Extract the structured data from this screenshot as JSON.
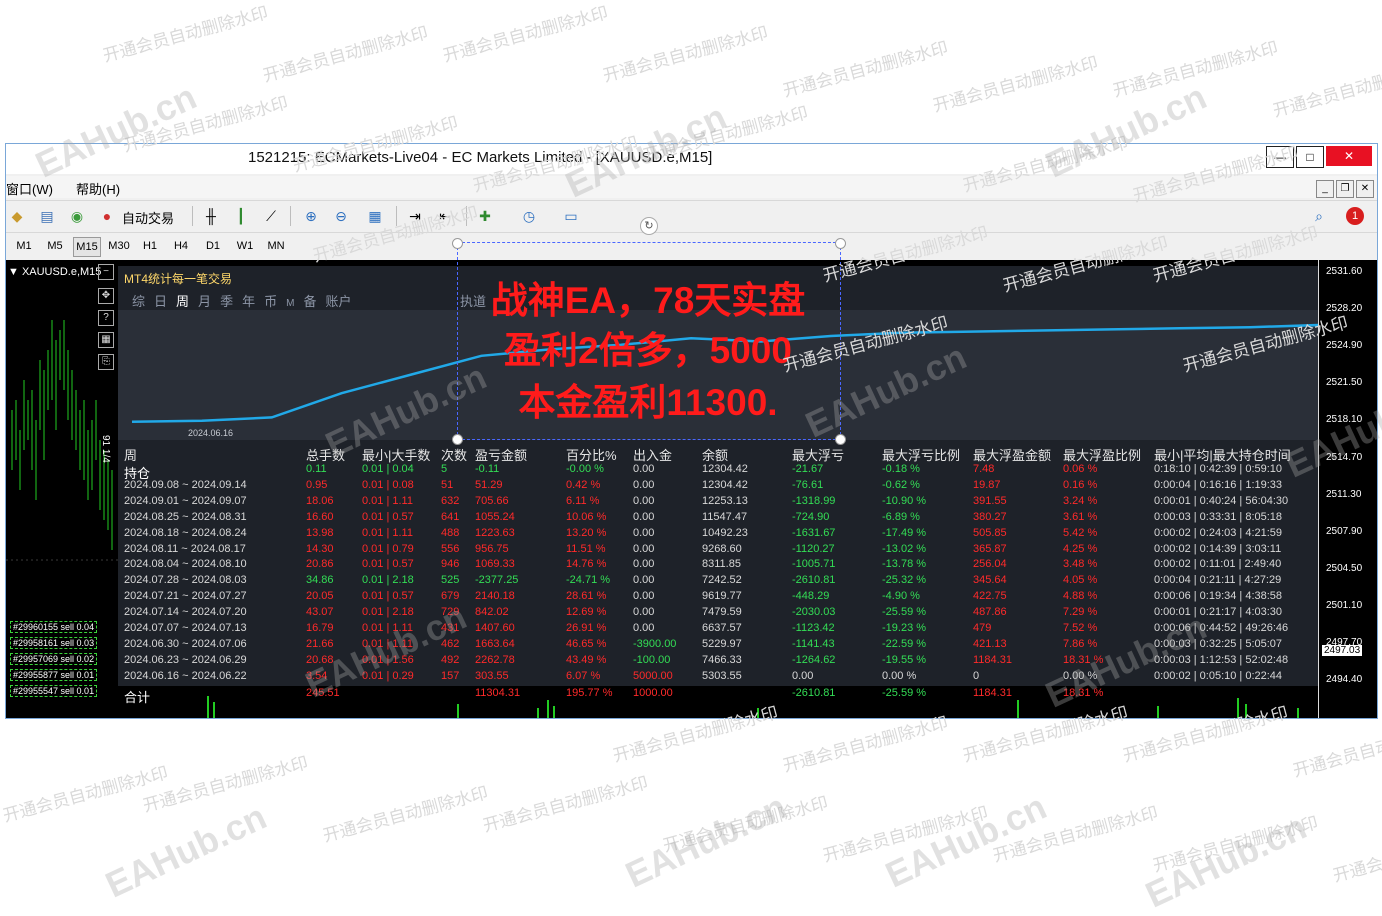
{
  "window": {
    "title": "1521215: ECMarkets-Live04 - EC Markets Limited - [XAUUSD.e,M15]",
    "minimize": "—",
    "maximize": "□",
    "close": "✕"
  },
  "menu": {
    "items": [
      "窗口(W)",
      "帮助(H)"
    ]
  },
  "toolbar": {
    "auto_trading_label": "自动交易"
  },
  "timeframes": [
    "M1",
    "M5",
    "M15",
    "M30",
    "H1",
    "H4",
    "D1",
    "W1",
    "MN"
  ],
  "chart": {
    "symbol_label": "▼ XAUUSD.e,M15",
    "side_label": "91 1/4",
    "price_ticks": [
      "2531.60",
      "2528.20",
      "2524.90",
      "2521.50",
      "2518.10",
      "2514.70",
      "2511.30",
      "2507.90",
      "2504.50",
      "2501.10",
      "2497.70",
      "2494.40"
    ],
    "current_price": "2497.03",
    "orders": [
      "#29960155 sell 0.04",
      "#29958161 sell 0.03",
      "#29957069 sell 0.02",
      "#29955877 sell 0.01",
      "#29955547 sell 0.01"
    ]
  },
  "panel": {
    "title": "MT4统计每一笔交易",
    "tabs": [
      "综",
      "日",
      "周",
      "月",
      "季",
      "年",
      "币",
      "M",
      "备",
      "账户"
    ],
    "active_tab": "周",
    "hidden_tab": "执道",
    "equity_date": "2024.06.16",
    "equity_curve": [
      0.12,
      0.13,
      0.16,
      0.38,
      0.55,
      0.72,
      0.78,
      0.82,
      0.88,
      0.85,
      0.9,
      0.93,
      0.94,
      0.95,
      0.96,
      0.97,
      0.98,
      1.0
    ],
    "headers": [
      "周",
      "总手数",
      "最小|大手数",
      "次数",
      "盈亏金额",
      "百分比%",
      "出入金",
      "余额",
      "最大浮亏",
      "最大浮亏比例",
      "最大浮盈金额",
      "最大浮盈比例",
      "最小|平均|最大持仓时间"
    ],
    "rows": [
      {
        "p": "持仓",
        "lots": "0.11",
        "mm": "0.01 | 0.04",
        "n": "5",
        "pl": "-0.11",
        "pct": "-0.00 %",
        "io": "0.00",
        "bal": "12304.42",
        "dd": "-21.67",
        "ddp": "-0.18 %",
        "mf": "7.48",
        "mfp": "0.06 %",
        "t": "0:18:10 | 0:42:39 | 0:59:10",
        "c": "g"
      },
      {
        "p": "2024.09.08 ~ 2024.09.14",
        "lots": "0.95",
        "mm": "0.01 | 0.08",
        "n": "51",
        "pl": "51.29",
        "pct": "0.42 %",
        "io": "0.00",
        "bal": "12304.42",
        "dd": "-76.61",
        "ddp": "-0.62 %",
        "mf": "19.87",
        "mfp": "0.16 %",
        "t": "0:00:04 | 0:16:16 | 1:19:33",
        "c": "r"
      },
      {
        "p": "2024.09.01 ~ 2024.09.07",
        "lots": "18.06",
        "mm": "0.01 | 1.11",
        "n": "632",
        "pl": "705.66",
        "pct": "6.11 %",
        "io": "0.00",
        "bal": "12253.13",
        "dd": "-1318.99",
        "ddp": "-10.90 %",
        "mf": "391.55",
        "mfp": "3.24 %",
        "t": "0:00:01 | 0:40:24 | 56:04:30",
        "c": "r"
      },
      {
        "p": "2024.08.25 ~ 2024.08.31",
        "lots": "16.60",
        "mm": "0.01 | 0.57",
        "n": "641",
        "pl": "1055.24",
        "pct": "10.06 %",
        "io": "0.00",
        "bal": "11547.47",
        "dd": "-724.90",
        "ddp": "-6.89 %",
        "mf": "380.27",
        "mfp": "3.61 %",
        "t": "0:00:03 | 0:33:31 | 8:05:18",
        "c": "r"
      },
      {
        "p": "2024.08.18 ~ 2024.08.24",
        "lots": "13.98",
        "mm": "0.01 | 1.11",
        "n": "488",
        "pl": "1223.63",
        "pct": "13.20 %",
        "io": "0.00",
        "bal": "10492.23",
        "dd": "-1631.67",
        "ddp": "-17.49 %",
        "mf": "505.85",
        "mfp": "5.42 %",
        "t": "0:00:02 | 0:24:03 | 4:21:59",
        "c": "r"
      },
      {
        "p": "2024.08.11 ~ 2024.08.17",
        "lots": "14.30",
        "mm": "0.01 | 0.79",
        "n": "556",
        "pl": "956.75",
        "pct": "11.51 %",
        "io": "0.00",
        "bal": "9268.60",
        "dd": "-1120.27",
        "ddp": "-13.02 %",
        "mf": "365.87",
        "mfp": "4.25 %",
        "t": "0:00:02 | 0:14:39 | 3:03:11",
        "c": "r"
      },
      {
        "p": "2024.08.04 ~ 2024.08.10",
        "lots": "20.86",
        "mm": "0.01 | 0.57",
        "n": "946",
        "pl": "1069.33",
        "pct": "14.76 %",
        "io": "0.00",
        "bal": "8311.85",
        "dd": "-1005.71",
        "ddp": "-13.78 %",
        "mf": "256.04",
        "mfp": "3.48 %",
        "t": "0:00:02 | 0:11:01 | 2:49:40",
        "c": "r"
      },
      {
        "p": "2024.07.28 ~ 2024.08.03",
        "lots": "34.86",
        "mm": "0.01 | 2.18",
        "n": "525",
        "pl": "-2377.25",
        "pct": "-24.71 %",
        "io": "0.00",
        "bal": "7242.52",
        "dd": "-2610.81",
        "ddp": "-25.32 %",
        "mf": "345.64",
        "mfp": "4.05 %",
        "t": "0:00:04 | 0:21:11 | 4:27:29",
        "c": "g"
      },
      {
        "p": "2024.07.21 ~ 2024.07.27",
        "lots": "20.05",
        "mm": "0.01 | 0.57",
        "n": "679",
        "pl": "2140.18",
        "pct": "28.61 %",
        "io": "0.00",
        "bal": "9619.77",
        "dd": "-448.29",
        "ddp": "-4.90 %",
        "mf": "422.75",
        "mfp": "4.88 %",
        "t": "0:00:06 | 0:19:34 | 4:38:58",
        "c": "r"
      },
      {
        "p": "2024.07.14 ~ 2024.07.20",
        "lots": "43.07",
        "mm": "0.01 | 2.18",
        "n": "729",
        "pl": "842.02",
        "pct": "12.69 %",
        "io": "0.00",
        "bal": "7479.59",
        "dd": "-2030.03",
        "ddp": "-25.59 %",
        "mf": "487.86",
        "mfp": "7.29 %",
        "t": "0:00:01 | 0:21:17 | 4:03:30",
        "c": "r"
      },
      {
        "p": "2024.07.07 ~ 2024.07.13",
        "lots": "16.79",
        "mm": "0.01 | 1.11",
        "n": "431",
        "pl": "1407.60",
        "pct": "26.91 %",
        "io": "0.00",
        "bal": "6637.57",
        "dd": "-1123.42",
        "ddp": "-19.23 %",
        "mf": "479",
        "mfp": "7.52 %",
        "t": "0:00:06 | 0:44:52 | 49:26:46",
        "c": "r"
      },
      {
        "p": "2024.06.30 ~ 2024.07.06",
        "lots": "21.66",
        "mm": "0.01 | 1.11",
        "n": "462",
        "pl": "1663.64",
        "pct": "46.65 %",
        "io": "-3900.00",
        "bal": "5229.97",
        "dd": "-1141.43",
        "ddp": "-22.59 %",
        "mf": "421.13",
        "mfp": "7.86 %",
        "t": "0:00:03 | 0:32:25 | 5:05:07",
        "c": "r"
      },
      {
        "p": "2024.06.23 ~ 2024.06.29",
        "lots": "20.68",
        "mm": "0.01 | 1.56",
        "n": "492",
        "pl": "2262.78",
        "pct": "43.49 %",
        "io": "-100.00",
        "bal": "7466.33",
        "dd": "-1264.62",
        "ddp": "-19.55 %",
        "mf": "1184.31",
        "mfp": "18.31 %",
        "t": "0:00:03 | 1:12:53 | 52:02:48",
        "c": "r"
      },
      {
        "p": "2024.06.16 ~ 2024.06.22",
        "lots": "3.54",
        "mm": "0.01 | 0.29",
        "n": "157",
        "pl": "303.55",
        "pct": "6.07 %",
        "io": "5000.00",
        "bal": "5303.55",
        "dd": "0.00",
        "ddp": "0.00 %",
        "mf": "0",
        "mfp": "0.00 %",
        "t": "0:00:02 | 0:05:10 | 0:22:44",
        "c": "r"
      }
    ],
    "total": {
      "p": "合计",
      "lots": "245.51",
      "pl": "11304.31",
      "pct": "195.77 %",
      "io": "1000.00",
      "dd": "-2610.81",
      "ddp": "-25.59 %",
      "mf": "1184.31",
      "mfp": "18.31 %"
    }
  },
  "overlay": {
    "lines": [
      "战神EA，78天实盘",
      "盈利2倍多，5000",
      "本金盈利11300."
    ]
  },
  "watermarks": {
    "text": "开通会员自动删除水印",
    "brand": "EAHub.cn"
  },
  "colors": {
    "profit": "#ff2a2a",
    "loss": "#33dd55",
    "neutral": "#d8d8d8",
    "equity_line": "#21a9e8",
    "overlay": "#ff1b1b"
  }
}
